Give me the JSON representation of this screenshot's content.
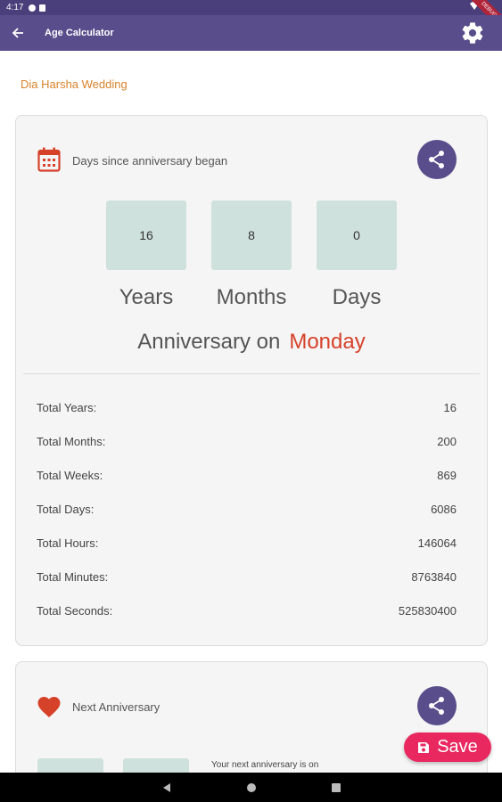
{
  "status_bar": {
    "time": "4:17"
  },
  "app_bar": {
    "title": "Age Calculator",
    "back_icon": "arrow-left-icon",
    "settings_icon": "gear-icon"
  },
  "event_name": "Dia Harsha Wedding",
  "anniversary_card": {
    "heading": "Days since anniversary began",
    "icon": "calendar-icon",
    "share_icon": "share-icon",
    "counts": [
      {
        "value": "16",
        "label": "Years"
      },
      {
        "value": "8",
        "label": "Months"
      },
      {
        "value": "0",
        "label": "Days"
      }
    ],
    "anniversary_prefix": "Anniversary on",
    "anniversary_day": "Monday",
    "stats": [
      {
        "label": "Total Years:",
        "value": "16"
      },
      {
        "label": "Total Months:",
        "value": "200"
      },
      {
        "label": "Total Weeks:",
        "value": "869"
      },
      {
        "label": "Total Days:",
        "value": "6086"
      },
      {
        "label": "Total Hours:",
        "value": "146064"
      },
      {
        "label": "Total Minutes:",
        "value": "8763840"
      },
      {
        "label": "Total Seconds:",
        "value": "525830400"
      }
    ]
  },
  "next_card": {
    "heading": "Next Anniversary",
    "icon": "heart-icon",
    "share_icon": "share-icon",
    "text": "Your next anniversary is on"
  },
  "save_fab": {
    "label": "Save",
    "icon": "save-icon"
  },
  "colors": {
    "app_bar": "#5a4d8c",
    "status_bar": "#4a3f7a",
    "accent_orange": "#d9822b",
    "accent_red": "#d6412a",
    "count_box": "#cfe1dc",
    "save_fab": "#e8285f"
  }
}
